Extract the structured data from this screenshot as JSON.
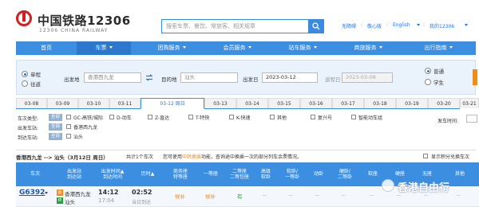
{
  "header": {
    "logo_cn": "中国铁路12306",
    "logo_en": "12306 CHINA RAILWAY",
    "search_placeholder": "搜索车票、餐饮、常旅客、相关规章",
    "links": [
      "无障碍",
      "敬心版",
      "English",
      "我的12306"
    ]
  },
  "nav": {
    "items": [
      {
        "label": "首页",
        "caret": false
      },
      {
        "label": "车票",
        "caret": true
      },
      {
        "label": "团购服务",
        "caret": true
      },
      {
        "label": "会员服务",
        "caret": true
      },
      {
        "label": "站车服务",
        "caret": true
      },
      {
        "label": "商旅服务",
        "caret": true
      },
      {
        "label": "出行指南",
        "caret": true
      }
    ],
    "active_index": 1
  },
  "query": {
    "trip_one_way": "单程",
    "trip_round": "往返",
    "from_label": "出发地",
    "from_value": "香港西九龙",
    "to_label": "目的地",
    "to_value": "汕头",
    "date_label": "出发日",
    "date_value": "2023-03-12",
    "return_label": "返程日",
    "return_value": "2023-03-08",
    "type_normal": "普通",
    "type_student": "学生"
  },
  "dates": [
    "03-08",
    "03-09",
    "03-10",
    "03-11",
    "03-12 周日",
    "03-13",
    "03-14",
    "03-15",
    "03-16",
    "03-17",
    "03-18",
    "03-19",
    "03-20",
    "03-21"
  ],
  "active_date_index": 4,
  "filters": {
    "train_type_label": "车次类型:",
    "all": "全部",
    "train_types": [
      "GC-高铁/城际",
      "D-动车",
      "Z-直达",
      "T-特快",
      "K-快速",
      "其他",
      "复兴号",
      "智能动车组"
    ],
    "depart_station_label": "出发车站:",
    "depart_stations": [
      "香港西九龙"
    ],
    "arrive_station_label": "到达车站:",
    "arrive_stations": [
      "汕头"
    ],
    "depart_time_label": "发车时间:"
  },
  "summary": {
    "route": "香港西九龙 --> 汕头（3月12日 周日）",
    "count": "共计1个车次",
    "tip_prefix": "您可使用",
    "tip_highlight": "中转换乘",
    "tip_suffix": "功能，查询途中换乘一次的部分列车余票情况。",
    "show_points": "显示积分兑换车次"
  },
  "table": {
    "headers": [
      "车次",
      "出发站\n到达站",
      "出发时间▲\n到达时间",
      "历时▲",
      "商务座\n特等座",
      "一等座",
      "二等座\n二等包座",
      "高级\n软卧",
      "软卧/\n一等卧",
      "动卧",
      "硬卧/\n二等卧",
      "软座",
      "硬座",
      "无座",
      "其他"
    ],
    "rows": [
      {
        "train_no": "G6392",
        "start_badge": "始",
        "end_badge": "终",
        "from_station": "香港西九龙",
        "to_station": "汕头",
        "depart_time": "14:12",
        "arrive_time": "17:04",
        "duration": "02:52",
        "day": "当日到达",
        "business": "候补",
        "first": "候补",
        "second": "有",
        "rest": [
          "--",
          "--",
          "--",
          "--",
          "--",
          "--",
          "--",
          "--"
        ]
      }
    ]
  },
  "watermark": "香港自由行",
  "colors": {
    "brand_red": "#d21f1f",
    "nav_blue": "#3b8ee0",
    "link_blue": "#2676e0",
    "orange": "#f08c1a",
    "green": "#2b9a3e"
  }
}
